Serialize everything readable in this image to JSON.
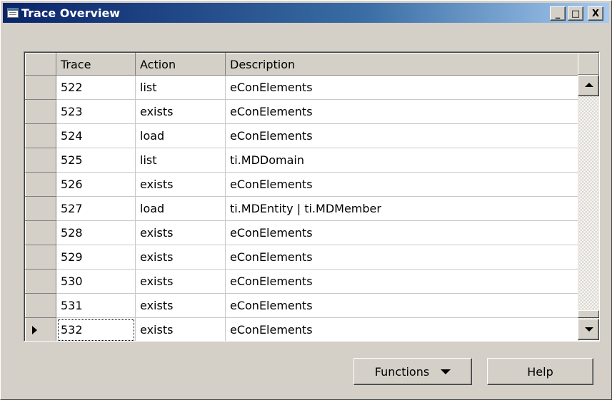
{
  "window": {
    "title": "Trace Overview",
    "controls": {
      "minimize": "_",
      "maximize": "□",
      "close": "X"
    },
    "title_icon": "table-icon"
  },
  "grid": {
    "columns": [
      "Trace",
      "Action",
      "Description"
    ],
    "rows": [
      {
        "trace": "522",
        "action": "list",
        "description": "eConElements"
      },
      {
        "trace": "523",
        "action": "exists",
        "description": "eConElements"
      },
      {
        "trace": "524",
        "action": "load",
        "description": "eConElements"
      },
      {
        "trace": "525",
        "action": "list",
        "description": "ti.MDDomain"
      },
      {
        "trace": "526",
        "action": "exists",
        "description": "eConElements"
      },
      {
        "trace": "527",
        "action": "load",
        "description": "ti.MDEntity | ti.MDMember"
      },
      {
        "trace": "528",
        "action": "exists",
        "description": "eConElements"
      },
      {
        "trace": "529",
        "action": "exists",
        "description": "eConElements"
      },
      {
        "trace": "530",
        "action": "exists",
        "description": "eConElements"
      },
      {
        "trace": "531",
        "action": "exists",
        "description": "eConElements"
      },
      {
        "trace": "532",
        "action": "exists",
        "description": "eConElements"
      }
    ],
    "current_row_index": 10
  },
  "buttons": {
    "functions": "Functions",
    "help": "Help"
  }
}
